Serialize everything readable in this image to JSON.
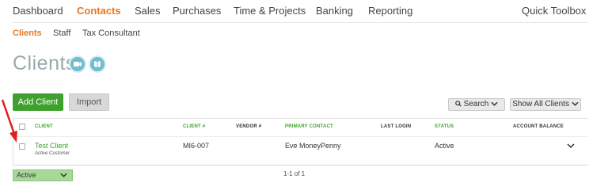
{
  "topnav": {
    "items": [
      "Dashboard",
      "Contacts",
      "Sales",
      "Purchases",
      "Time & Projects",
      "Banking",
      "Reporting"
    ],
    "quick_toolbox": "Quick Toolbox"
  },
  "subnav": {
    "items": [
      "Clients",
      "Staff",
      "Tax Consultant"
    ]
  },
  "page": {
    "title": "Clients"
  },
  "toolbar": {
    "add_client": "Add Client",
    "import": "Import",
    "search": "Search",
    "filter": "Show All Clients"
  },
  "table": {
    "headers": {
      "client": "CLIENT",
      "client_no": "CLIENT #",
      "vendor_no": "VENDOR #",
      "primary_contact": "PRIMARY CONTACT",
      "last_login": "LAST LOGIN",
      "status": "STATUS",
      "account_balance": "ACCOUNT BALANCE"
    },
    "rows": [
      {
        "client": "Test Client",
        "client_sub": "Active Customer",
        "client_no": "MI6-007",
        "vendor_no": "",
        "primary_contact": "Eve MoneyPenny",
        "last_login": "",
        "status": "Active",
        "account_balance": ""
      }
    ]
  },
  "footer": {
    "status_filter": "Active",
    "pagination": "1-1 of 1"
  },
  "colors": {
    "accent_orange": "#e87722",
    "accent_green": "#3fa12d",
    "annotation_red": "#e02020"
  },
  "icons": [
    "video-icon",
    "book-icon",
    "search-icon",
    "chevron-down-icon",
    "annotation-arrow-icon"
  ]
}
